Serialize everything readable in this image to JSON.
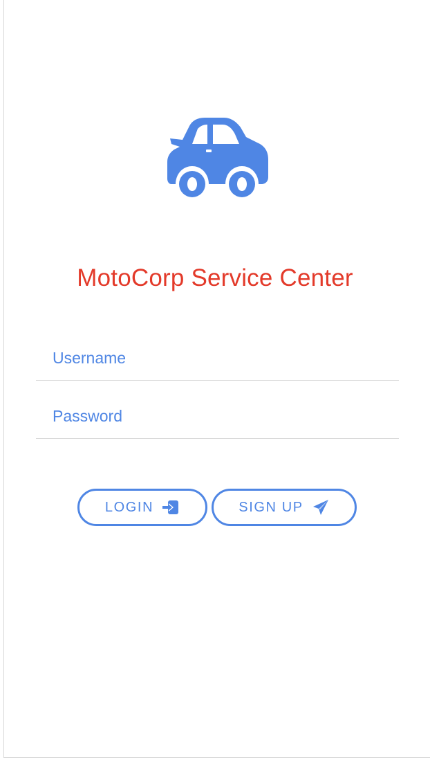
{
  "app": {
    "title": "MotoCorp Service Center",
    "logo_icon": "car-icon"
  },
  "form": {
    "username": {
      "placeholder": "Username",
      "value": ""
    },
    "password": {
      "placeholder": "Password",
      "value": ""
    }
  },
  "actions": {
    "login_label": "LOGIN",
    "login_icon": "sign-in-icon",
    "signup_label": "SIGN UP",
    "signup_icon": "paper-plane-icon"
  },
  "colors": {
    "accent": "#4f86e4",
    "title": "#e33a2a",
    "divider": "#d9d9d9"
  }
}
